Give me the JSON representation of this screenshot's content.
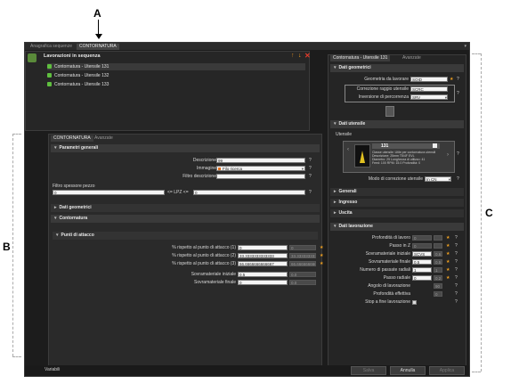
{
  "callouts": {
    "a": "A",
    "b": "B",
    "c": "C"
  },
  "tabs": {
    "anagrafica": "Anagrafica sequenze",
    "contornatura": "CONTORNATURA"
  },
  "sequence": {
    "title": "Lavorazioni in sequenza",
    "items": [
      "Contornatura - Utensile 131",
      "Contornatura - Utensile 132",
      "Contornatura - Utensile 133"
    ]
  },
  "left": {
    "tab_main": "CONTORNATURA",
    "tab_adv": "Avanzate",
    "sec_general": "Parametri generali",
    "descrizione_label": "Descrizione",
    "descrizione_value": "99",
    "immagine_label": "Immagine",
    "immagine_value": "Filo ricerca",
    "filtro_label": "Filtro descrizione",
    "spessore_label": "Filtro spessore pezzo",
    "spessore_min": "0",
    "lpz_label": "<= LPZ <=",
    "spessore_max": "0",
    "sec_geo": "Dati geometrici",
    "sec_cont": "Contornatura",
    "sec_attacco": "Punti di attacco",
    "p1_label": "% rispetto al punto di attacco (1)",
    "p1_value": "0",
    "p1_dis": "0",
    "p2_label": "% rispetto al punto di attacco (2)",
    "p2_value": "33.3333333333333",
    "p2_dis": "33.3333333333333",
    "p3_label": "% rispetto al punto di attacco (3)",
    "p3_value": "66.6666666666667",
    "p3_dis": "66.6666666666667",
    "sovr_iniz_label": "Sovramateriale iniziale",
    "sovr_iniz_value": "0.5",
    "sovr_iniz_dis": "0.0",
    "sovr_fin_label": "Sovramateriale finale",
    "sovr_fin_value": "0",
    "sovr_fin_dis": "0.0",
    "q": "?"
  },
  "right": {
    "tab_main": "Contornatura - Utensile 131",
    "tab_adv": "Avanzate",
    "sec_geo": "Dati geometrici",
    "geom_label": "Geometria da lavorare",
    "geom_value": "SOID",
    "corr_label": "Correzione raggio utensile",
    "corr_value": "SCRC",
    "inv_label": "Inversione di percorrenza",
    "inv_value": "SRV",
    "sec_ut": "Dati utensile",
    "utensile_label": "Utensile",
    "tool_num": "131",
    "tool_line1": "Classe utensile: Utile per contornatura utensili",
    "tool_line2": "Descrizione: 25mm T5/4F EVL",
    "tool_line3": "Diametro: 25  Lunghezza di utilizzo: 41",
    "tool_line4": "Feed: 100  RPM: 15.0  Profondità: 0",
    "modo_label": "Modo di correzione utensile",
    "modo_value": "In CN",
    "sec_generali": "Generali",
    "sec_ingresso": "Ingresso",
    "sec_uscita": "Uscita",
    "sec_lav": "Dati lavorazione",
    "prof_label": "Profondità di lavoro",
    "prof_value": "0",
    "passoz_label": "Passo in Z",
    "passoz_value": "0",
    "sovr_iniz_label": "Sovramateriale iniziale",
    "sovr_iniz_value": "SCVS",
    "sovr_iniz_dis": "0.6",
    "sovr_fin_label": "Sovramateriale finale",
    "sovr_fin_value": "0.5",
    "sovr_fin_dis": "0.5",
    "npass_label": "Numero di passate radiali",
    "npass_value": "1",
    "npass_dis": "1",
    "passorad_label": "Passo radiale",
    "passorad_value": "0",
    "passorad_dis": "0.2",
    "angolo_label": "Angolo di lavorazione",
    "angolo_value": "90",
    "proffett_label": "Profondità effettiva",
    "proffett_value": "0",
    "stop_label": "Stop a fine lavorazione",
    "q": "?"
  },
  "footer": {
    "variabili": "Variabili",
    "salva": "Salva",
    "annulla": "Annulla",
    "applica": "Applica"
  },
  "colors": {
    "accent": "#f0a020",
    "delete": "#e03a2a",
    "background": "#1c1c1c"
  }
}
